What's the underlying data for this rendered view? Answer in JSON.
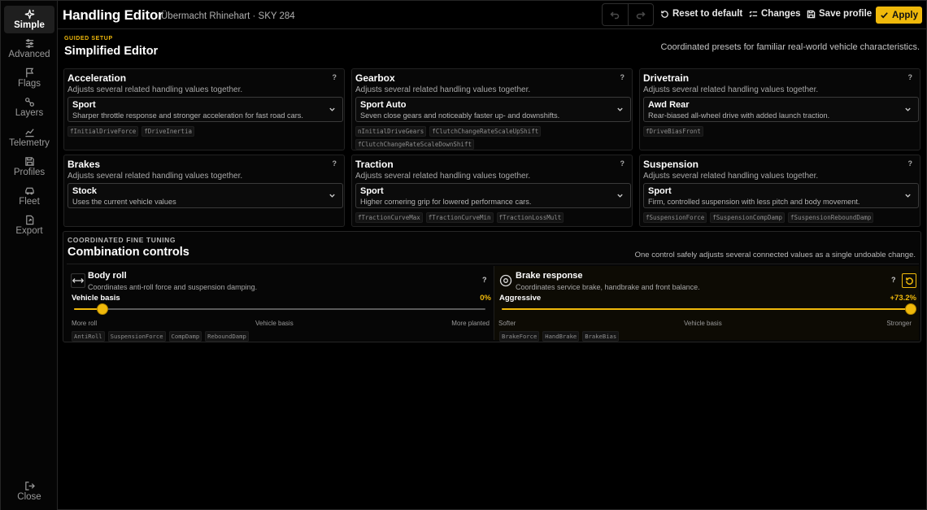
{
  "sidebar": {
    "items": [
      {
        "label": "Simple",
        "icon": "sparkle-icon",
        "active": true
      },
      {
        "label": "Advanced",
        "icon": "sliders-icon"
      },
      {
        "label": "Flags",
        "icon": "flag-icon"
      },
      {
        "label": "Layers",
        "icon": "layers-icon"
      },
      {
        "label": "Telemetry",
        "icon": "chart-icon"
      },
      {
        "label": "Profiles",
        "icon": "save-icon"
      },
      {
        "label": "Fleet",
        "icon": "car-icon"
      },
      {
        "label": "Export",
        "icon": "export-icon"
      }
    ],
    "close_label": "Close"
  },
  "header": {
    "title": "Handling Editor",
    "subtitle": "Übermacht Rhinehart · SKY 284",
    "reset_label": "Reset to default",
    "changes_label": "Changes",
    "save_label": "Save profile",
    "apply_label": "Apply"
  },
  "guided": {
    "eyebrow": "GUIDED SETUP",
    "title": "Simplified Editor",
    "note": "Coordinated presets for familiar real-world vehicle characteristics."
  },
  "cards": [
    {
      "title": "Acceleration",
      "desc": "Adjusts several related handling values together.",
      "help": "?",
      "value": "Sport",
      "value_desc": "Sharper throttle response and stronger acceleration for fast road cars.",
      "tags": [
        "fInitialDriveForce",
        "fDriveInertia"
      ]
    },
    {
      "title": "Gearbox",
      "desc": "Adjusts several related handling values together.",
      "help": "?",
      "value": "Sport Auto",
      "value_desc": "Seven close gears and noticeably faster up- and downshifts.",
      "tags": [
        "nInitialDriveGears",
        "fClutchChangeRateScaleUpShift",
        "fClutchChangeRateScaleDownShift"
      ]
    },
    {
      "title": "Drivetrain",
      "desc": "Adjusts several related handling values together.",
      "help": "?",
      "value": "Awd Rear",
      "value_desc": "Rear-biased all-wheel drive with added launch traction.",
      "tags": [
        "fDriveBiasFront"
      ]
    },
    {
      "title": "Brakes",
      "desc": "Adjusts several related handling values together.",
      "help": "?",
      "value": "Stock",
      "value_desc": "Uses the current vehicle values",
      "tags": []
    },
    {
      "title": "Traction",
      "desc": "Adjusts several related handling values together.",
      "help": "?",
      "value": "Sport",
      "value_desc": "Higher cornering grip for lowered performance cars.",
      "tags": [
        "fTractionCurveMax",
        "fTractionCurveMin",
        "fTractionLossMult"
      ]
    },
    {
      "title": "Suspension",
      "desc": "Adjusts several related handling values together.",
      "help": "?",
      "value": "Sport",
      "value_desc": "Firm, controlled suspension with less pitch and body movement.",
      "tags": [
        "fSuspensionForce",
        "fSuspensionCompDamp",
        "fSuspensionReboundDamp"
      ]
    }
  ],
  "combo": {
    "eyebrow": "COORDINATED FINE TUNING",
    "title": "Combination controls",
    "note": "One control safely adjusts several connected values as a single undoable change.",
    "controls": [
      {
        "title": "Body roll",
        "desc": "Coordinates anti-roll force and suspension damping.",
        "help": "?",
        "icon": "arrows-horizontal-icon",
        "state_label": "Vehicle basis",
        "value_text": "0%",
        "position": 0.07,
        "ticks": [
          "More roll",
          "Vehicle basis",
          "More planted"
        ],
        "tags": [
          "AntiRoll",
          "SuspensionForce",
          "CompDamp",
          "ReboundDamp"
        ]
      },
      {
        "title": "Brake response",
        "desc": "Coordinates service brake, handbrake and front balance.",
        "help": "?",
        "icon": "brake-disc-icon",
        "state_label": "Aggressive",
        "value_text": "+73.2%",
        "position": 1.0,
        "ticks": [
          "Softer",
          "Vehicle basis",
          "Stronger"
        ],
        "tags": [
          "BrakeForce",
          "HandBrake",
          "BrakeBias"
        ]
      }
    ]
  },
  "colors": {
    "accent": "#f0b90b",
    "background": "#000000",
    "panel": "#070707",
    "border": "#262626"
  }
}
